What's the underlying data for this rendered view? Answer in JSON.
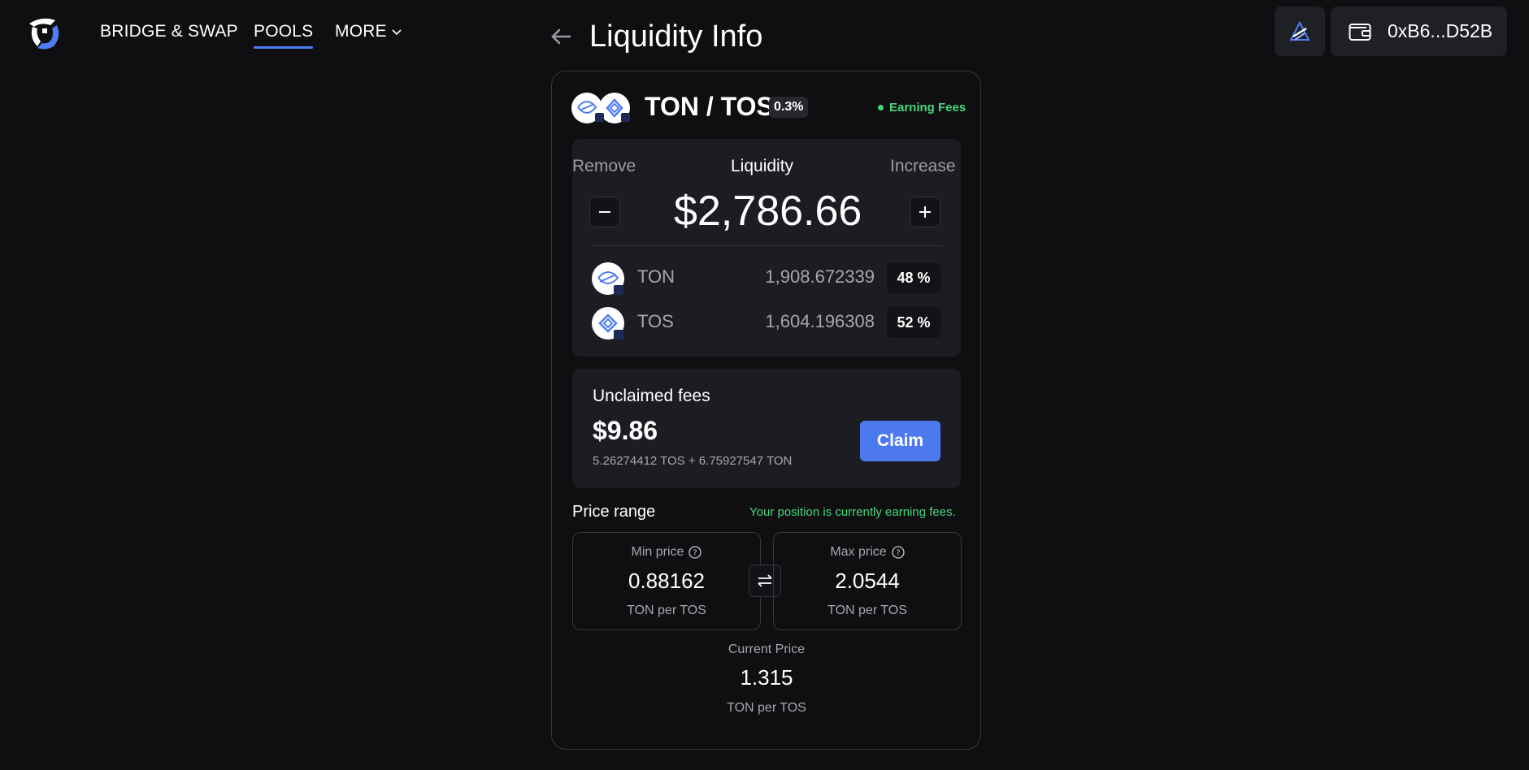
{
  "nav": {
    "links": [
      "BRIDGE & SWAP",
      "POOLS",
      "MORE"
    ],
    "active": "POOLS"
  },
  "header": {
    "wallet_address": "0xB6...D52B",
    "network_icon": "titan-network-icon",
    "wallet_icon": "wallet-icon"
  },
  "page": {
    "title": "Liquidity Info"
  },
  "position": {
    "pair": "TON / TOS",
    "fee_tier": "0.3%",
    "status": "Earning Fees",
    "remove_label": "Remove",
    "liquidity_label": "Liquidity",
    "increase_label": "Increase",
    "liquidity_value": "$2,786.66",
    "tokens": [
      {
        "symbol": "TON",
        "amount": "1,908.672339",
        "share": "48 %"
      },
      {
        "symbol": "TOS",
        "amount": "1,604.196308",
        "share": "52 %"
      }
    ]
  },
  "fees": {
    "title": "Unclaimed fees",
    "value": "$9.86",
    "detail": "5.26274412 TOS + 6.75927547 TON",
    "claim_label": "Claim"
  },
  "price_range": {
    "title": "Price range",
    "status": "Your position is currently earning fees.",
    "min": {
      "label": "Min price",
      "value": "0.88162",
      "unit": "TON per TOS"
    },
    "max": {
      "label": "Max price",
      "value": "2.0544",
      "unit": "TON per TOS"
    },
    "current": {
      "label": "Current Price",
      "value": "1.315",
      "unit": "TON per TOS"
    }
  },
  "colors": {
    "background": "#0f0f12",
    "panel": "#1c1d22",
    "accent": "#4d79ef",
    "positive": "#45d77b"
  }
}
